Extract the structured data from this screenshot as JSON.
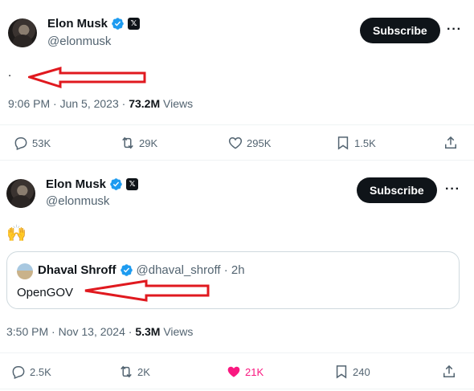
{
  "tweet1": {
    "author_name": "Elon Musk",
    "handle": "@elonmusk",
    "subscribe_label": "Subscribe",
    "more_label": "···",
    "text": ".",
    "timestamp": "9:06 PM · Jun 5, 2023 · ",
    "views_count": "73.2M",
    "views_label": " Views",
    "replies": "53K",
    "reposts": "29K",
    "likes": "295K",
    "bookmarks": "1.5K"
  },
  "tweet2": {
    "author_name": "Elon Musk",
    "handle": "@elonmusk",
    "subscribe_label": "Subscribe",
    "more_label": "···",
    "text": "🙌",
    "quote": {
      "author_name": "Dhaval Shroff",
      "handle_time": "@dhaval_shroff · 2h",
      "text": "OpenGOV"
    },
    "timestamp": "3:50 PM · Nov 13, 2024 · ",
    "views_count": "5.3M",
    "views_label": " Views",
    "replies": "2.5K",
    "reposts": "2K",
    "likes": "21K",
    "bookmarks": "240"
  },
  "colors": {
    "verified_blue": "#1d9bf0",
    "liked_pink": "#f91880",
    "arrow_red": "#e0191f",
    "secondary_text": "#536471"
  },
  "icons": {
    "reply": "reply-icon",
    "repost": "repost-icon",
    "like": "heart-icon",
    "bookmark": "bookmark-icon",
    "share": "share-icon",
    "verified": "verified-badge-icon",
    "x_affiliate": "x-logo-icon"
  }
}
